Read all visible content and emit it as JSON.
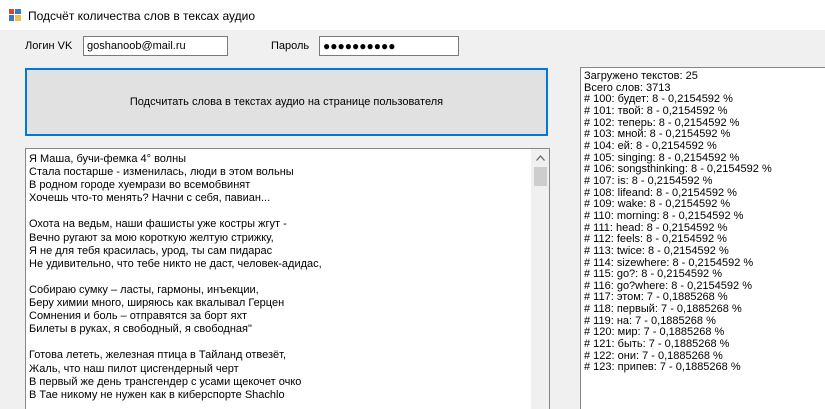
{
  "window": {
    "title": "Подсчёт количества слов в тексах аудио"
  },
  "login": {
    "label": "Логин VK",
    "value": "goshanoob@mail.ru"
  },
  "password": {
    "label": "Пароль",
    "value": "●●●●●●●●●●"
  },
  "count_button": {
    "label": "Подсчитать слова в текстах аудио на странице пользователя"
  },
  "lyrics": {
    "lines": [
      "Я Маша, бучи-фемка 4° волны",
      "Стала постарше - изменилась, люди в этом вольны",
      "В родном городе хуемрази во всемобвинят",
      "Хочешь что-то менять? Начни с себя, павиан...",
      "",
      "Охота на ведьм, наши фашисты уже костры жгут -",
      "Вечно ругают за мою короткую желтую стрижку,",
      "Я не для тебя красилась, урод, ты сам пидарас",
      "Не удивительно, что тебе никто не даст, человек-адидас,",
      "",
      "Собираю сумку – ласты, гармоны, инъекции,",
      "Беру химии много, ширяюсь как вкалывал Герцен",
      "Сомнения и боль – отправятся за борт яхт",
      "Билеты в руках, я свободный, я свободная\"",
      "",
      "Готова лететь, железная птица в Тайланд отвезёт,",
      "Жаль, что наш пилот цисгендерный черт",
      "В первый же день трансгендер с усами щекочет очко",
      "В Тае никому не нужен как в киберспорте Shachlo"
    ]
  },
  "stats": {
    "lines": [
      "Загружено текстов: 25",
      "Всего слов: 3713",
      "# 100: будет: 8 - 0,2154592 %",
      "# 101: твой: 8 - 0,2154592 %",
      "# 102: теперь: 8 - 0,2154592 %",
      "# 103: мной: 8 - 0,2154592 %",
      "# 104: ей: 8 - 0,2154592 %",
      "# 105: singing: 8 - 0,2154592 %",
      "# 106: songsthinking: 8 - 0,2154592 %",
      "# 107: is: 8 - 0,2154592 %",
      "# 108: lifeand: 8 - 0,2154592 %",
      "# 109: wake: 8 - 0,2154592 %",
      "# 110: morning: 8 - 0,2154592 %",
      "# 111: head: 8 - 0,2154592 %",
      "# 112: feels: 8 - 0,2154592 %",
      "# 113: twice: 8 - 0,2154592 %",
      "# 114: sizewhere: 8 - 0,2154592 %",
      "# 115: go?: 8 - 0,2154592 %",
      "# 116: go?where: 8 - 0,2154592 %",
      "# 117: этом: 7 - 0,1885268 %",
      "# 118: первый: 7 - 0,1885268 %",
      "# 119: на: 7 - 0,1885268 %",
      "# 120: мир: 7 - 0,1885268 %",
      "# 121: быть: 7 - 0,1885268 %",
      "# 122: они: 7 - 0,1885268 %",
      "# 123: припев: 7 - 0,1885268 %"
    ]
  }
}
